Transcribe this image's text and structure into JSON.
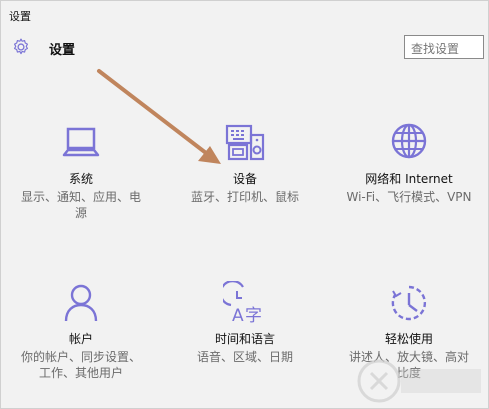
{
  "window": {
    "title": "设置"
  },
  "header": {
    "title": "设置",
    "search_placeholder": "查找设置"
  },
  "tiles": [
    {
      "name": "系统",
      "desc_line1": "显示、通知、应用、电",
      "desc_line2": "源"
    },
    {
      "name": "设备",
      "desc_line1": "蓝牙、打印机、鼠标",
      "desc_line2": ""
    },
    {
      "name": "网络和 Internet",
      "desc_line1": "Wi-Fi、飞行模式、VPN",
      "desc_line2": ""
    },
    {
      "name": "帐户",
      "desc_line1": "你的帐户、同步设置、",
      "desc_line2": "工作、其他用户"
    },
    {
      "name": "时间和语言",
      "desc_line1": "语音、区域、日期",
      "desc_line2": ""
    },
    {
      "name": "轻松使用",
      "desc_line1": "讲述人、放大镜、高对",
      "desc_line2": "比度"
    }
  ],
  "colors": {
    "accent": "#7b74d6",
    "arrow": "#c0855d"
  }
}
